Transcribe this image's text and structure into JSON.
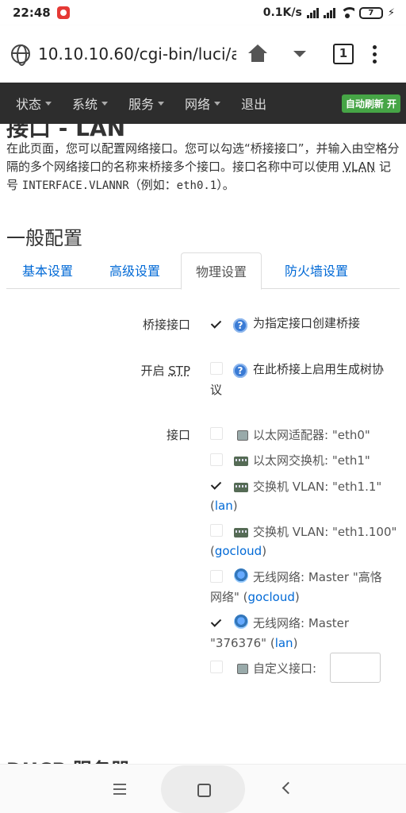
{
  "status": {
    "time": "22:48",
    "net_speed": "0.1K/s",
    "battery": "7"
  },
  "browser": {
    "url": "10.10.10.60/cgi-bin/luci/a",
    "tab_count": "1"
  },
  "nav": {
    "items": [
      {
        "label": "状态",
        "dropdown": true
      },
      {
        "label": "系统",
        "dropdown": true
      },
      {
        "label": "服务",
        "dropdown": true
      },
      {
        "label": "网络",
        "dropdown": true
      },
      {
        "label": "退出",
        "dropdown": false
      }
    ],
    "auto_refresh": "自动刷新 开"
  },
  "page": {
    "title": "接口 - LAN",
    "desc_1": "在此页面，您可以配置网络接口。您可以勾选“桥接接口”，并输入由空格分隔的多个网络接口的名称来桥接多个接口。接口名称中可以使用 ",
    "desc_vlan": "VLAN",
    "desc_2": " 记号 ",
    "desc_code": "INTERFACE.VLANNR",
    "desc_3": "（例如：",
    "desc_example": "eth0.1",
    "desc_4": "）。",
    "section_title": "一般配置",
    "next_section_title": "DHCP 服务器"
  },
  "tabs": [
    {
      "label": "基本设置",
      "active": false
    },
    {
      "label": "高级设置",
      "active": false
    },
    {
      "label": "物理设置",
      "active": true
    },
    {
      "label": "防火墙设置",
      "active": false
    }
  ],
  "form": {
    "bridge": {
      "label": "桥接接口",
      "checked": true,
      "help": "为指定接口创建桥接"
    },
    "stp": {
      "label_prefix": "开启 ",
      "label_abbr": "STP",
      "checked": false,
      "help_line1": "在此桥接上启用生成树协",
      "help_line2": "议"
    },
    "interfaces": {
      "label": "接口",
      "items": [
        {
          "icon": "ethernet-icon",
          "checked": false,
          "line1": "以太网适配器: \"eth0\"",
          "net": ""
        },
        {
          "icon": "switch-icon",
          "checked": false,
          "line1": "以太网交换机: \"eth1\"",
          "net": ""
        },
        {
          "icon": "switch-icon",
          "checked": true,
          "line1": "交换机 VLAN: \"eth1.1\"",
          "net": "lan"
        },
        {
          "icon": "switch-icon",
          "checked": false,
          "line1": "交换机 VLAN: \"eth1.100\"",
          "net": "gocloud"
        },
        {
          "icon": "wifi-icon",
          "checked": false,
          "line1": "无线网络: Master \"高恪",
          "line2": "网络\" ",
          "net": "gocloud"
        },
        {
          "icon": "wifi-icon",
          "checked": true,
          "line1": "无线网络: Master",
          "line2": "\"376376\" ",
          "net": "lan"
        }
      ],
      "custom_label": "自定义接口:",
      "custom_value": ""
    }
  }
}
